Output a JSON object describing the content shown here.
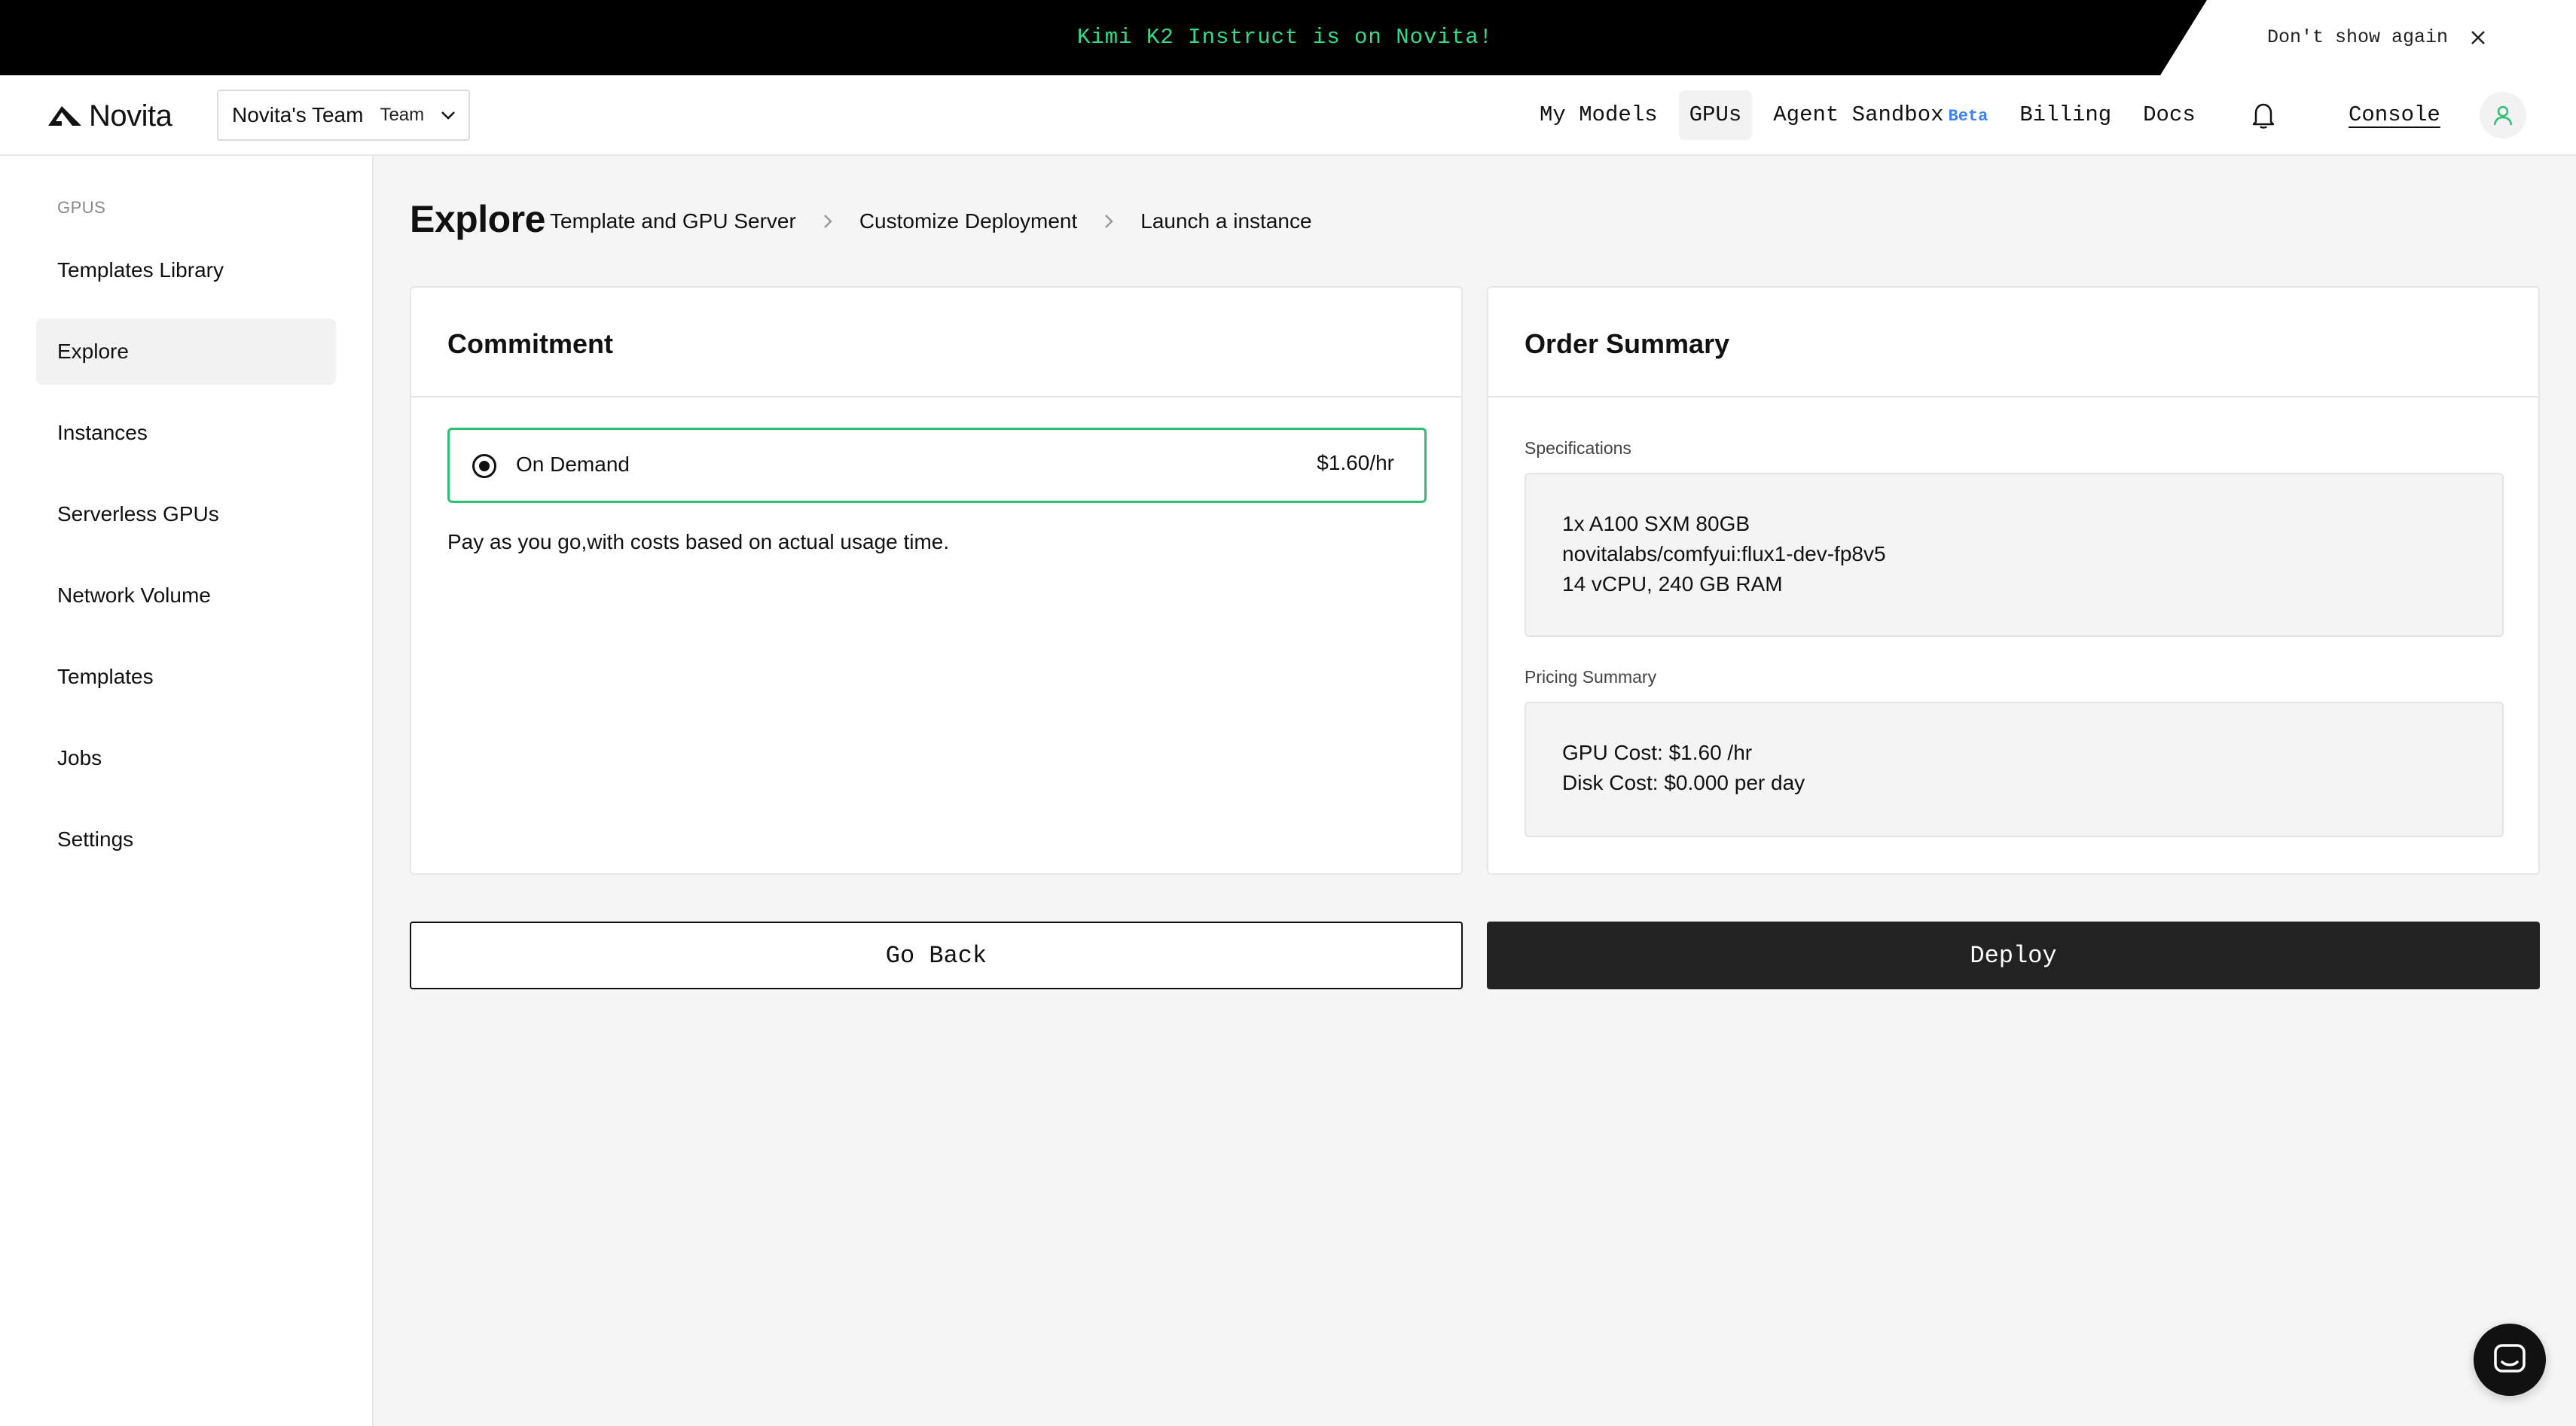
{
  "banner": {
    "message": "Kimi K2 Instruct is on Novita!",
    "dismiss_label": "Don't show again",
    "close_icon": "close-icon",
    "text_color": "#2fdc8b"
  },
  "header": {
    "brand": "Novita",
    "team": {
      "name": "Novita's Team",
      "tag": "Team"
    },
    "nav": [
      {
        "label": "My Models",
        "active": false
      },
      {
        "label": "GPUs",
        "active": true
      },
      {
        "label": "Agent Sandbox",
        "badge": "Beta",
        "active": false
      },
      {
        "label": "Billing",
        "active": false
      },
      {
        "label": "Docs",
        "active": false
      }
    ],
    "console_label": "Console"
  },
  "sidebar": {
    "heading": "GPUS",
    "items": [
      {
        "label": "Templates Library",
        "active": false
      },
      {
        "label": "Explore",
        "active": true
      },
      {
        "label": "Instances",
        "active": false
      },
      {
        "label": "Serverless GPUs",
        "active": false
      },
      {
        "label": "Network Volume",
        "active": false
      },
      {
        "label": "Templates",
        "active": false
      },
      {
        "label": "Jobs",
        "active": false
      },
      {
        "label": "Settings",
        "active": false
      }
    ]
  },
  "main": {
    "title": "Explore",
    "breadcrumb": [
      "Template and GPU Server",
      "Customize Deployment",
      "Launch a instance"
    ],
    "commitment": {
      "title": "Commitment",
      "option_label": "On Demand",
      "option_price": "$1.60/hr",
      "description": "Pay as you go,with costs based on actual usage time.",
      "accent_color": "#2fbf71"
    },
    "order_summary": {
      "title": "Order Summary",
      "specifications_label": "Specifications",
      "specifications": [
        "1x A100 SXM 80GB",
        "novitalabs/comfyui:flux1-dev-fp8v5",
        "14 vCPU, 240 GB RAM"
      ],
      "pricing_label": "Pricing Summary",
      "pricing": [
        "GPU Cost: $1.60 /hr",
        "Disk Cost: $0.000 per day"
      ]
    },
    "actions": {
      "back_label": "Go Back",
      "deploy_label": "Deploy"
    }
  }
}
